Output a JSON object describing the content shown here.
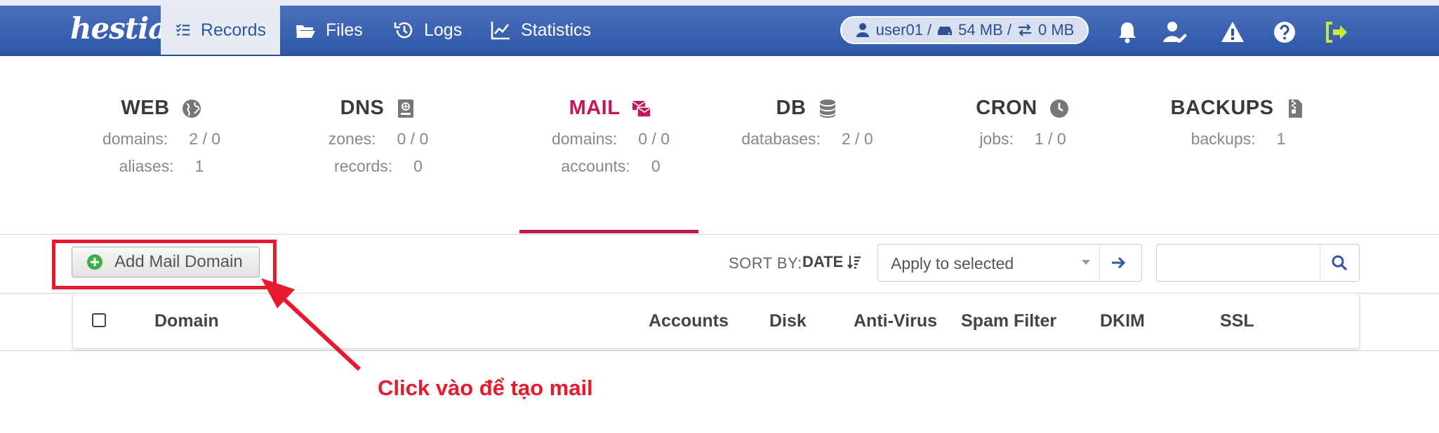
{
  "nav": {
    "logo": "hestia",
    "items": [
      {
        "label": "Records",
        "icon": "list-check-icon",
        "active": true
      },
      {
        "label": "Files",
        "icon": "folder-open-icon"
      },
      {
        "label": "Logs",
        "icon": "history-icon"
      },
      {
        "label": "Statistics",
        "icon": "chart-line-icon"
      }
    ],
    "usage": {
      "user": "user01 /",
      "disk": "54 MB /",
      "bandwidth": "0 MB"
    },
    "icons": [
      "bell-icon",
      "user-edit-icon",
      "warning-icon",
      "help-icon",
      "logout-icon"
    ]
  },
  "stats": {
    "web": {
      "title": "WEB",
      "rows": [
        {
          "k": "domains:",
          "v": "2 / 0"
        },
        {
          "k": "aliases:",
          "v": "1"
        }
      ]
    },
    "dns": {
      "title": "DNS",
      "rows": [
        {
          "k": "zones:",
          "v": "0 / 0"
        },
        {
          "k": "records:",
          "v": "0"
        }
      ]
    },
    "mail": {
      "title": "MAIL",
      "rows": [
        {
          "k": "domains:",
          "v": "0 / 0"
        },
        {
          "k": "accounts:",
          "v": "0"
        }
      ]
    },
    "db": {
      "title": "DB",
      "rows": [
        {
          "k": "databases:",
          "v": "2 / 0"
        }
      ]
    },
    "cron": {
      "title": "CRON",
      "rows": [
        {
          "k": "jobs:",
          "v": "1 / 0"
        }
      ]
    },
    "backups": {
      "title": "BACKUPS",
      "rows": [
        {
          "k": "backups:",
          "v": "1"
        }
      ]
    }
  },
  "toolbar": {
    "add_label": "Add Mail Domain",
    "sort_by_label": "SORT BY:",
    "sort_value": "DATE",
    "apply_label": "Apply to selected",
    "search_placeholder": ""
  },
  "table": {
    "columns": [
      "Domain",
      "Accounts",
      "Disk",
      "Anti-Virus",
      "Spam Filter",
      "DKIM",
      "SSL"
    ]
  },
  "annotation": {
    "text": "Click vào để tạo mail",
    "color": "#e8192c"
  },
  "colors": {
    "nav_bg": "#3a62b3",
    "accent_mail": "#c2185b",
    "add_icon": "#3cb043",
    "exit_icon": "#c6e93a"
  }
}
